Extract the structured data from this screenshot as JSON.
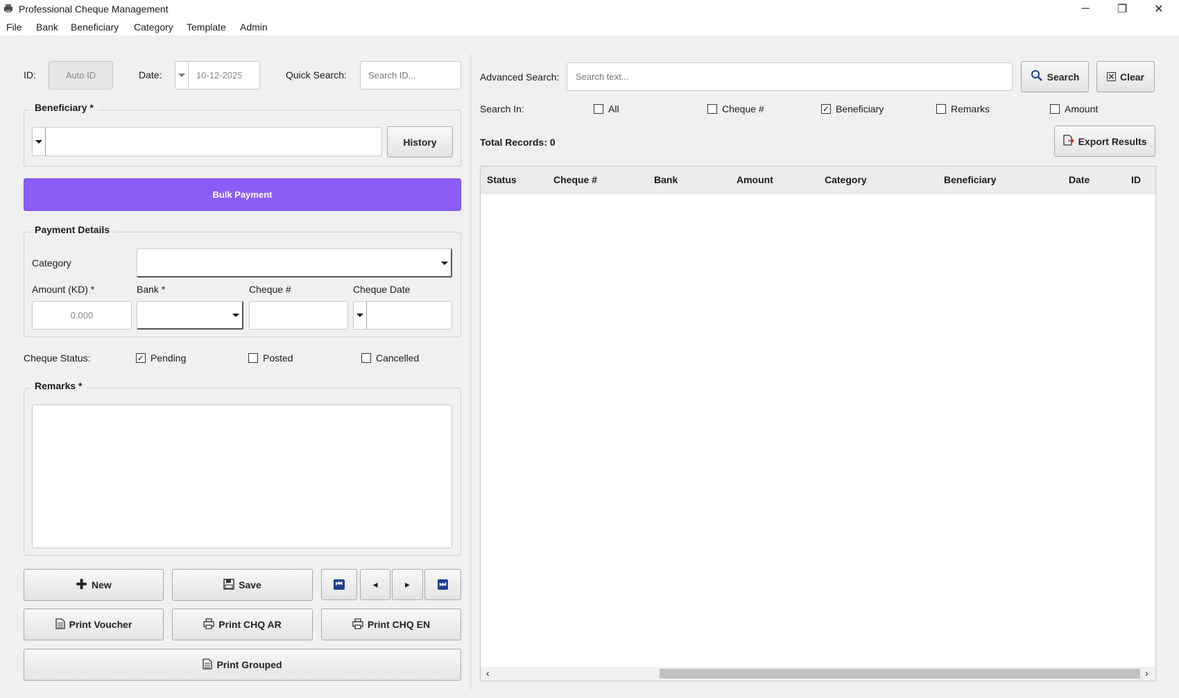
{
  "window": {
    "title": "Professional Cheque Management",
    "minimize": "─",
    "restore": "❐",
    "close": "✕"
  },
  "menu": [
    "File",
    "Bank",
    "Beneficiary",
    "Category",
    "Template",
    "Admin"
  ],
  "form": {
    "id_label": "ID:",
    "id_value": "Auto ID",
    "date_label": "Date:",
    "date_value": "10-12-2025",
    "quick_search_label": "Quick Search:",
    "quick_search_placeholder": "Search ID...",
    "beneficiary_legend": "Beneficiary *",
    "history_button": "History",
    "bulk_payment_button": "Bulk Payment",
    "payment_details_legend": "Payment Details",
    "category_label": "Category",
    "amount_label": "Amount (KD) *",
    "amount_placeholder": "0.000",
    "bank_label": "Bank *",
    "cheque_no_label": "Cheque #",
    "cheque_date_label": "Cheque Date",
    "cheque_status_label": "Cheque Status:",
    "status_options": [
      {
        "label": "Pending",
        "checked": true
      },
      {
        "label": "Posted",
        "checked": false
      },
      {
        "label": "Cancelled",
        "checked": false
      }
    ],
    "remarks_legend": "Remarks *"
  },
  "actions": {
    "new": "New",
    "save": "Save",
    "print_voucher": "Print Voucher",
    "print_chq_ar": "Print CHQ AR",
    "print_chq_en": "Print CHQ EN",
    "print_grouped": "Print Grouped",
    "nav_first": "⏮",
    "nav_prev": "◂",
    "nav_next": "▸",
    "nav_last": "⏭"
  },
  "search": {
    "advanced_label": "Advanced Search:",
    "placeholder": "Search text...",
    "search_button": "Search",
    "clear_button": "Clear",
    "search_in_label": "Search In:",
    "fields": [
      {
        "label": "All",
        "checked": false
      },
      {
        "label": "Cheque #",
        "checked": false
      },
      {
        "label": "Beneficiary",
        "checked": true
      },
      {
        "label": "Remarks",
        "checked": false
      },
      {
        "label": "Amount",
        "checked": false
      }
    ],
    "total_records": "Total Records: 0",
    "export_button": "Export Results"
  },
  "table": {
    "columns": [
      "Status",
      "Cheque #",
      "Bank",
      "Amount",
      "Category",
      "Beneficiary",
      "Date",
      "ID"
    ],
    "rows": []
  },
  "colors": {
    "accent": "#8b5cf6",
    "navy_button": "#1f3f8f"
  }
}
